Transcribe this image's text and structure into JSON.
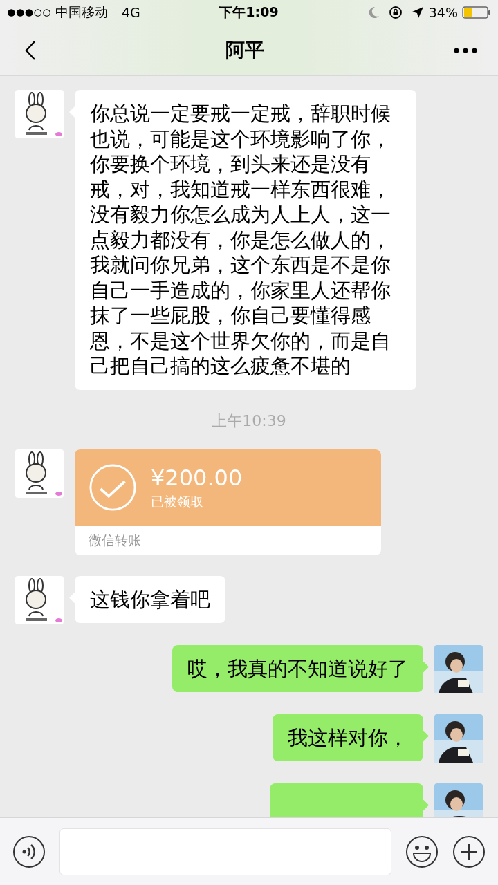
{
  "status_bar": {
    "carrier": "中国移动",
    "network": "4G",
    "time": "下午1:09",
    "battery": "34%"
  },
  "nav": {
    "title": "阿平"
  },
  "messages": [
    {
      "kind": "text",
      "outgoing": false,
      "text": "你总说一定要戒一定戒，辞职时候也说，可能是这个环境影响了你，你要换个环境，到头来还是没有戒，对，我知道戒一样东西很难，没有毅力你怎么成为人上人，这一点毅力都没有，你是怎么做人的，我就问你兄弟，这个东西是不是你自己一手造成的，你家里人还帮你抹了一些屁股，你自己要懂得感恩，不是这个世界欠你的，而是自己把自己搞的这么疲惫不堪的"
    },
    {
      "kind": "time",
      "text": "上午10:39"
    },
    {
      "kind": "transfer",
      "outgoing": false,
      "amount": "¥200.00",
      "status": "已被领取",
      "footer": "微信转账"
    },
    {
      "kind": "text",
      "outgoing": false,
      "text": "这钱你拿着吧"
    },
    {
      "kind": "text",
      "outgoing": true,
      "text": "哎，我真的不知道说好了"
    },
    {
      "kind": "text",
      "outgoing": true,
      "text": "我这样对你，"
    },
    {
      "kind": "cut",
      "outgoing": true
    }
  ]
}
